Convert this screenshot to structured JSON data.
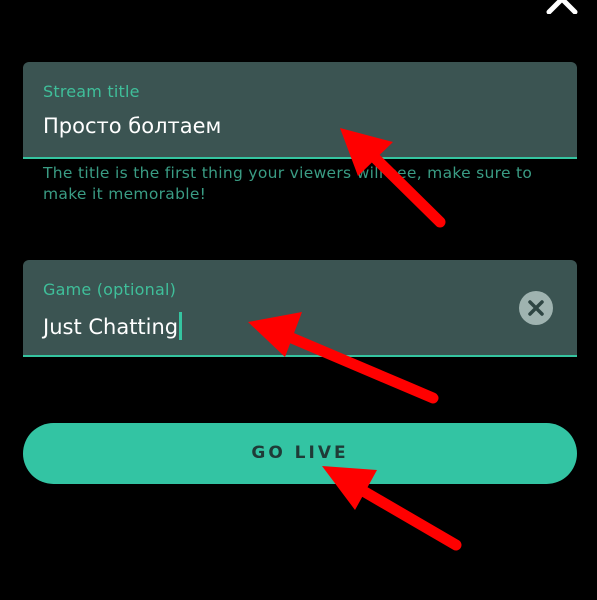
{
  "header": {
    "close_icon": "close-icon"
  },
  "stream_title": {
    "label": "Stream title",
    "value": "Просто болтаем",
    "helper": "The title is the first thing your viewers will see, make sure to make it memorable!"
  },
  "game": {
    "label": "Game (optional)",
    "value": "Just Chatting",
    "clear_icon": "clear-circle-icon"
  },
  "actions": {
    "go_live_label": "GO LIVE"
  },
  "annotations": {
    "arrow_color": "#ff0000",
    "arrow_icon": "red-arrow-icon"
  },
  "colors": {
    "accent": "#35c4a0",
    "field_bg": "#3b5452",
    "background": "#000000"
  }
}
